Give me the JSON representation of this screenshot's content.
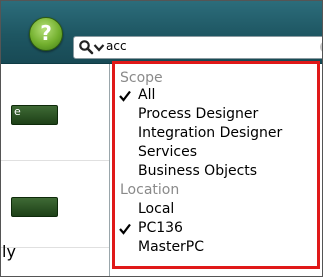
{
  "header": {
    "help_symbol": "?",
    "search": {
      "value": "acc",
      "icon": "search-icon"
    }
  },
  "left_panel": {
    "button1_label": "e",
    "side_text": "ly"
  },
  "dropdown": {
    "border_color": "#e01818",
    "sections": [
      {
        "heading": "Scope",
        "items": [
          {
            "label": "All",
            "checked": true
          },
          {
            "label": "Process Designer",
            "checked": false
          },
          {
            "label": "Integration Designer",
            "checked": false
          },
          {
            "label": "Services",
            "checked": false
          },
          {
            "label": "Business Objects",
            "checked": false
          }
        ]
      },
      {
        "heading": "Location",
        "items": [
          {
            "label": "Local",
            "checked": false
          },
          {
            "label": "PC136",
            "checked": true
          },
          {
            "label": "MasterPC",
            "checked": false
          }
        ]
      }
    ]
  }
}
